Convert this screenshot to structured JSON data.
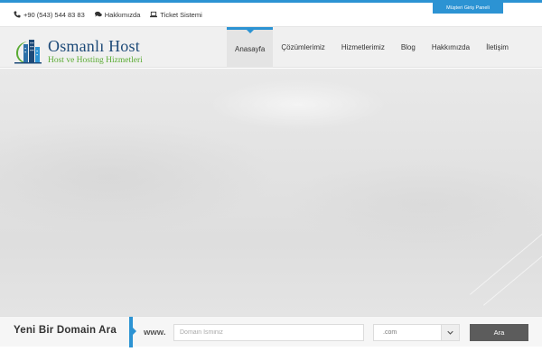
{
  "topbar": {
    "phone": "+90 (543) 544 83 83",
    "about": "Hakkımızda",
    "ticket": "Ticket Sistemi",
    "panel_button": "Müşteri Giriş Paneli"
  },
  "brand": {
    "name": "Osmanlı Host",
    "tagline": "Host ve Hosting Hizmetleri",
    "accent_color": "#2c93d3",
    "logo_green": "#5aab33",
    "logo_blue": "#1d4a78"
  },
  "nav": {
    "items": [
      {
        "label": "Anasayfa",
        "active": true
      },
      {
        "label": "Çözümlerimiz"
      },
      {
        "label": "Hizmetlerimiz"
      },
      {
        "label": "Blog"
      },
      {
        "label": "Hakkımızda"
      },
      {
        "label": "İletişim"
      }
    ]
  },
  "domain_search": {
    "title": "Yeni Bir Domain Ara",
    "prefix": "www.",
    "placeholder": "Domain İsminiz",
    "tld_selected": ".com",
    "button": "Ara"
  },
  "icons": {
    "phone": "phone-icon",
    "about": "comments-icon",
    "ticket": "laptop-icon",
    "dropdown": "chevron-down-icon"
  }
}
